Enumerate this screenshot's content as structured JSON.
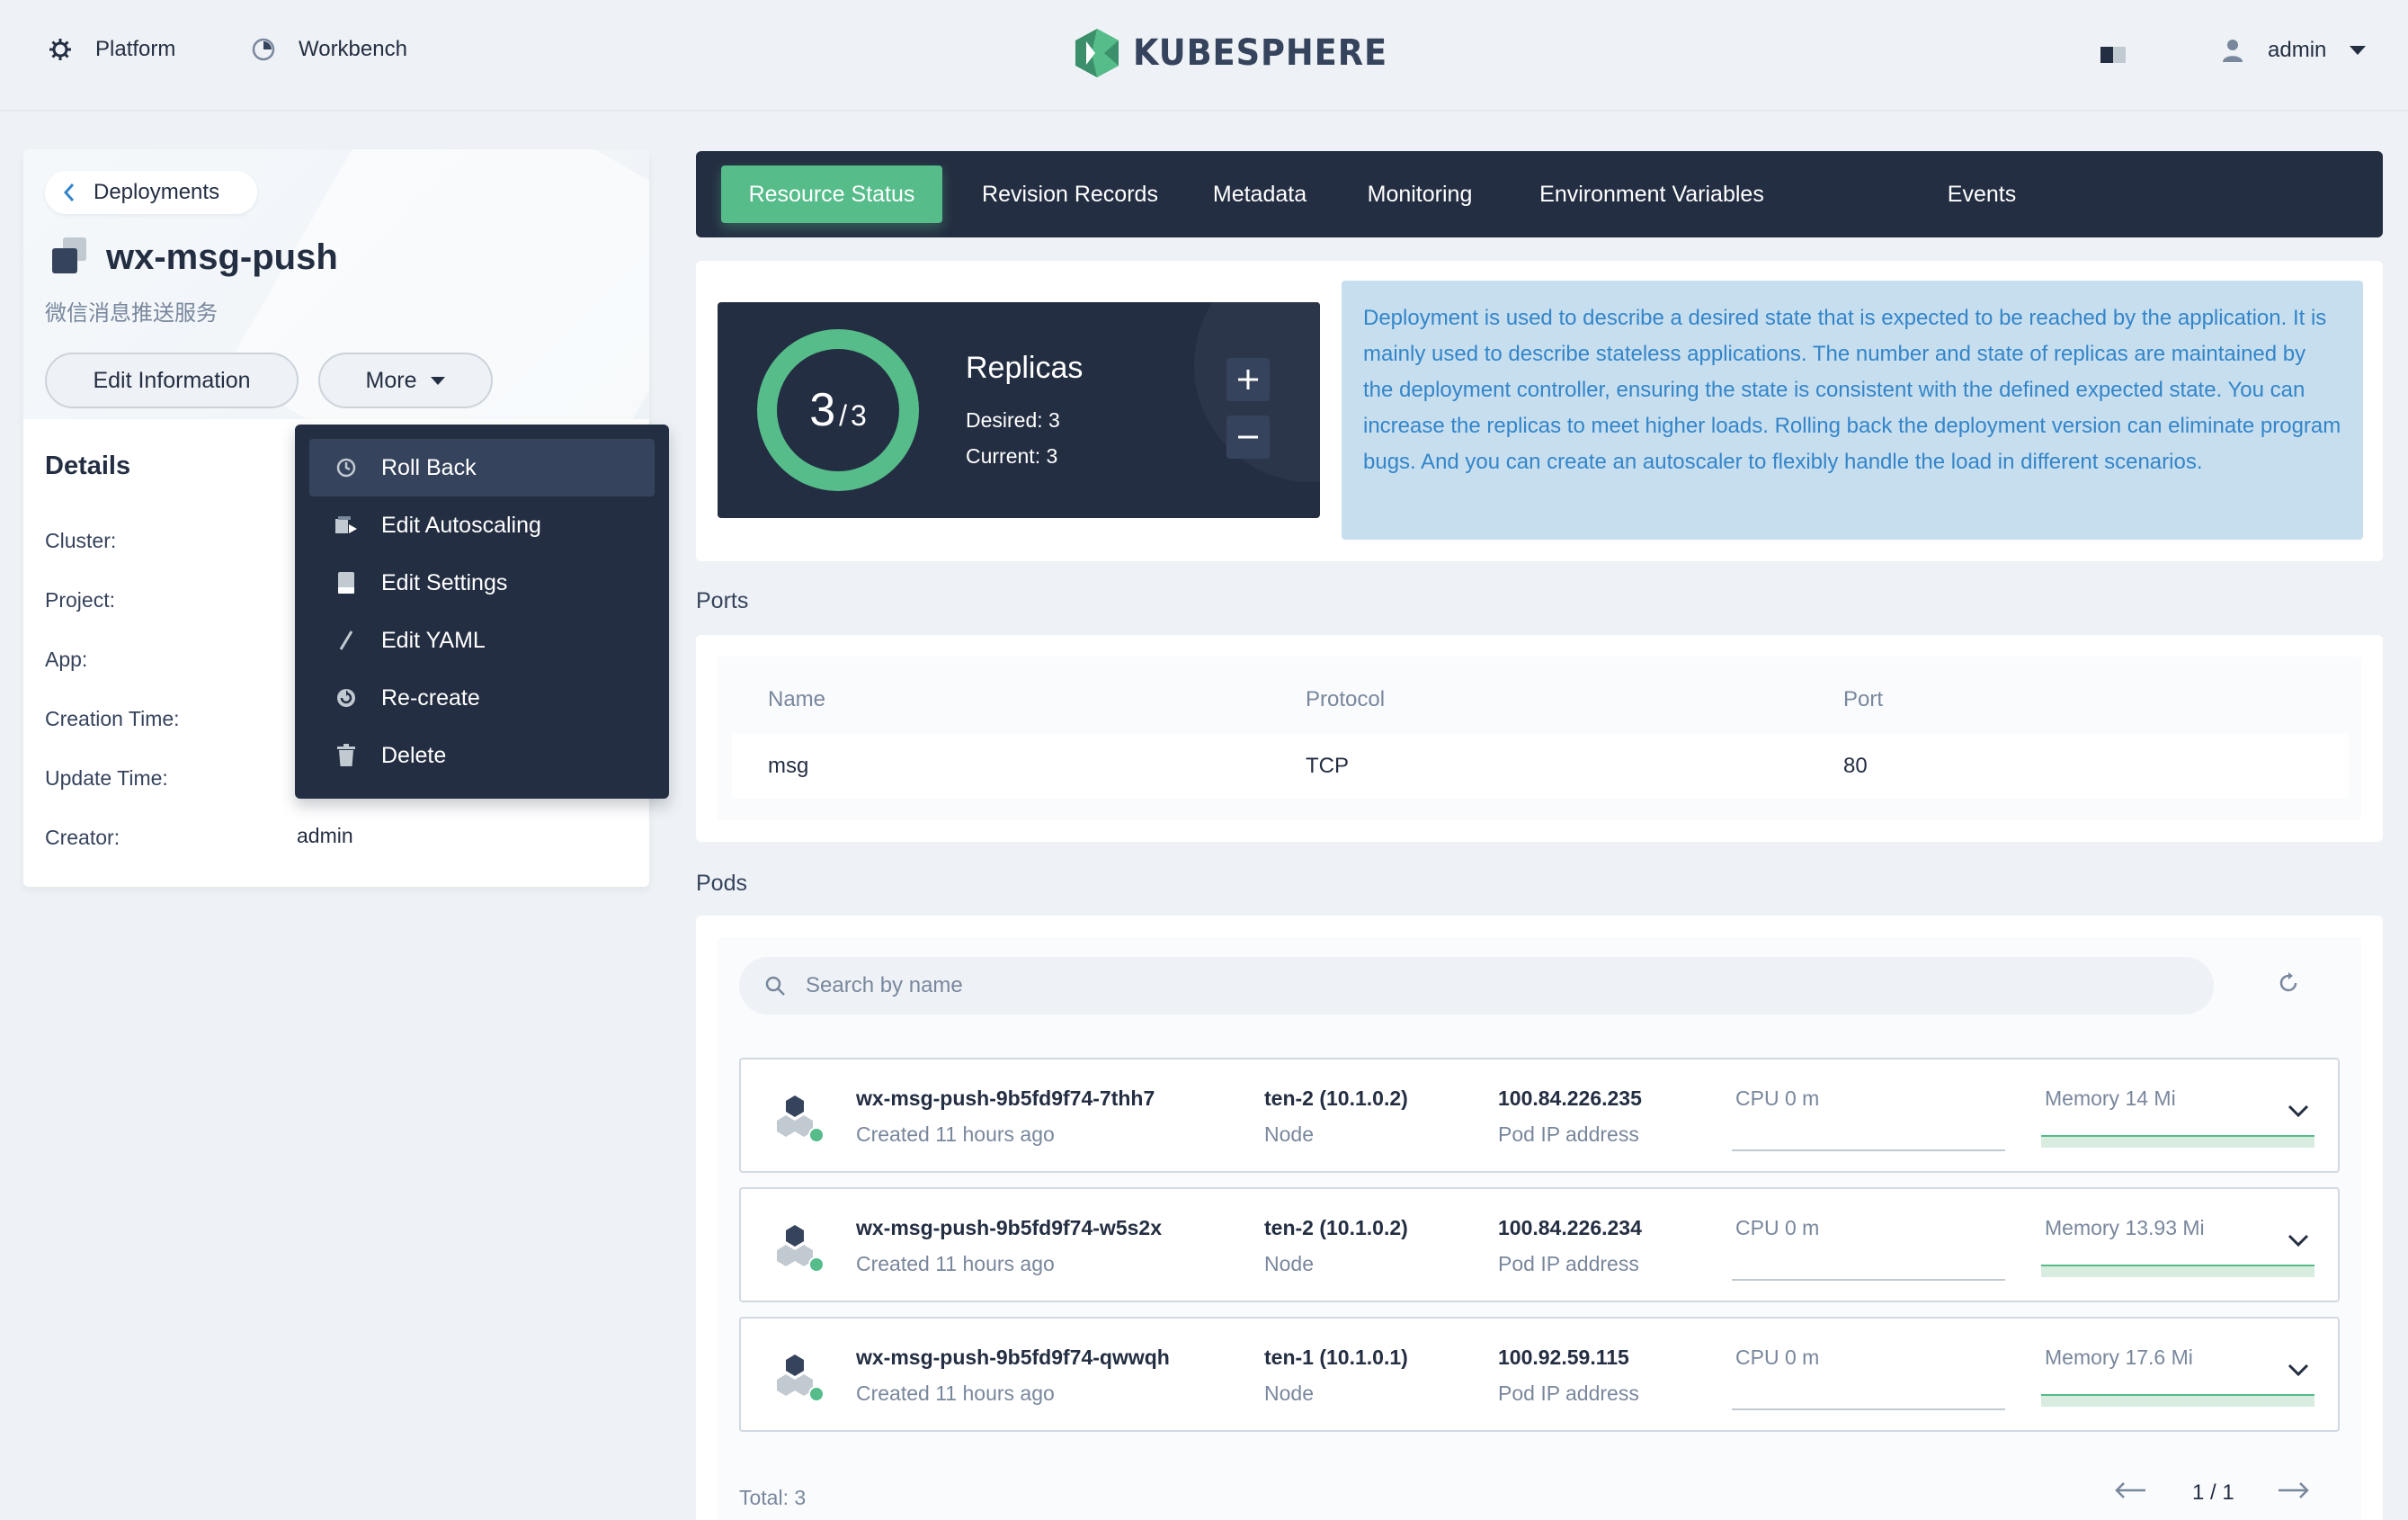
{
  "topbar": {
    "platform_label": "Platform",
    "workbench_label": "Workbench",
    "logo_text": "KUBESPHERE",
    "user_name": "admin"
  },
  "left": {
    "back_label": "Deployments",
    "resource_name": "wx-msg-push",
    "resource_desc": "微信消息推送服务",
    "edit_info_label": "Edit Information",
    "more_label": "More",
    "details_title": "Details",
    "details": [
      {
        "label": "Cluster:",
        "value": ""
      },
      {
        "label": "Project:",
        "value": ""
      },
      {
        "label": "App:",
        "value": ""
      },
      {
        "label": "Creation Time:",
        "value": ""
      },
      {
        "label": "Update Time:",
        "value": ""
      },
      {
        "label": "Creator:",
        "value": "admin"
      }
    ]
  },
  "dropdown": {
    "items": [
      {
        "label": "Roll Back",
        "icon": "history-icon"
      },
      {
        "label": "Edit Autoscaling",
        "icon": "autoscaling-icon"
      },
      {
        "label": "Edit Settings",
        "icon": "storage-icon"
      },
      {
        "label": "Edit YAML",
        "icon": "pen-icon"
      },
      {
        "label": "Re-create",
        "icon": "restart-icon"
      },
      {
        "label": "Delete",
        "icon": "trash-icon"
      }
    ]
  },
  "tabs": [
    {
      "label": "Resource Status",
      "active": true
    },
    {
      "label": "Revision Records"
    },
    {
      "label": "Metadata"
    },
    {
      "label": "Monitoring"
    },
    {
      "label": "Environment Variables"
    },
    {
      "label": "Events"
    }
  ],
  "replicas": {
    "current_big": "3",
    "total_small": "3",
    "title": "Replicas",
    "desired_text": "Desired: 3",
    "current_text": "Current: 3",
    "info": "Deployment is used to describe a desired state that is expected to be reached by the application. It is mainly used to describe stateless applications. The number and state of replicas are maintained by the deployment controller, ensuring the state is consistent with the defined expected state. You can increase the replicas to meet higher loads. Rolling back the deployment version can eliminate program bugs. And you can create an autoscaler to flexibly handle the load in different scenarios."
  },
  "ports": {
    "section_label": "Ports",
    "headers": [
      "Name",
      "Protocol",
      "Port"
    ],
    "rows": [
      [
        "msg",
        "TCP",
        "80"
      ]
    ]
  },
  "pods": {
    "section_label": "Pods",
    "search_placeholder": "Search by name",
    "items": [
      {
        "name": "wx-msg-push-9b5fd9f74-7thh7",
        "created": "Created 11 hours ago",
        "node": "ten-2 (10.1.0.2)",
        "node_label": "Node",
        "ip": "100.84.226.235",
        "ip_label": "Pod IP address",
        "cpu": "CPU 0 m",
        "memory": "Memory 14 Mi"
      },
      {
        "name": "wx-msg-push-9b5fd9f74-w5s2x",
        "created": "Created 11 hours ago",
        "node": "ten-2 (10.1.0.2)",
        "node_label": "Node",
        "ip": "100.84.226.234",
        "ip_label": "Pod IP address",
        "cpu": "CPU 0 m",
        "memory": "Memory 13.93 Mi"
      },
      {
        "name": "wx-msg-push-9b5fd9f74-qwwqh",
        "created": "Created 11 hours ago",
        "node": "ten-1 (10.1.0.1)",
        "node_label": "Node",
        "ip": "100.92.59.115",
        "ip_label": "Pod IP address",
        "cpu": "CPU 0 m",
        "memory": "Memory 17.6 Mi"
      }
    ],
    "total": "Total: 3",
    "page": "1 / 1"
  },
  "colors": {
    "accent": "#55bc8a",
    "dark": "#242e42",
    "info_bg": "#c7deef",
    "info_text": "#3385c9"
  }
}
